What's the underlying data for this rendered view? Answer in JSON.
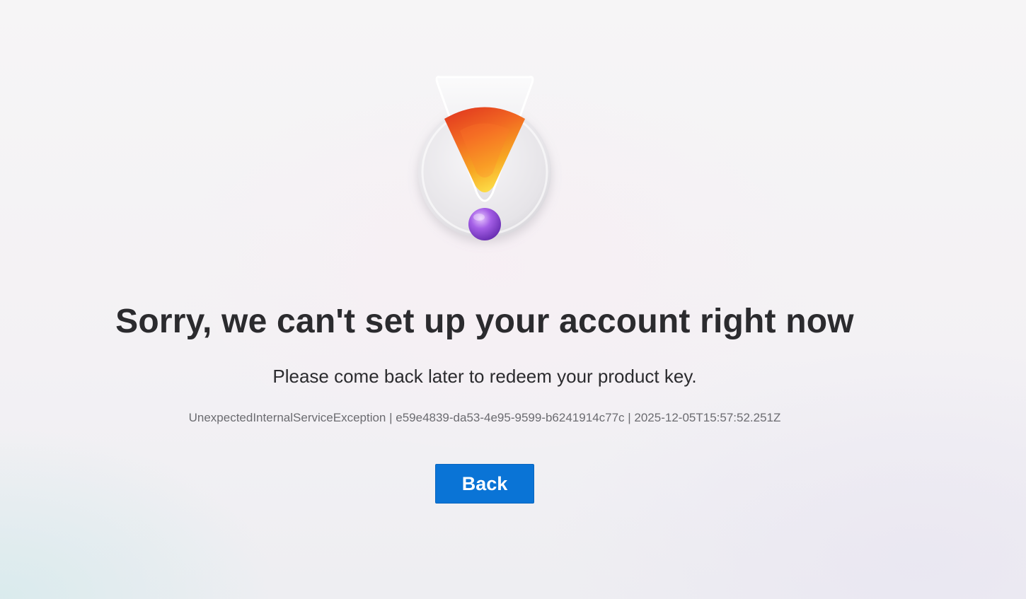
{
  "illustration": {
    "icon": "warning-exclamation-icon"
  },
  "message": {
    "title": "Sorry, we can't set up your account right now",
    "subtitle": "Please come back later to redeem your product key.",
    "error_detail": "UnexpectedInternalServiceException | e59e4839-da53-4e95-9599-b6241914c77c | 2025-12-05T15:57:52.251Z"
  },
  "actions": {
    "back_label": "Back"
  },
  "colors": {
    "accent": "#0a74d6",
    "title_text": "#2b2b2e",
    "detail_text": "#6b6b70"
  }
}
